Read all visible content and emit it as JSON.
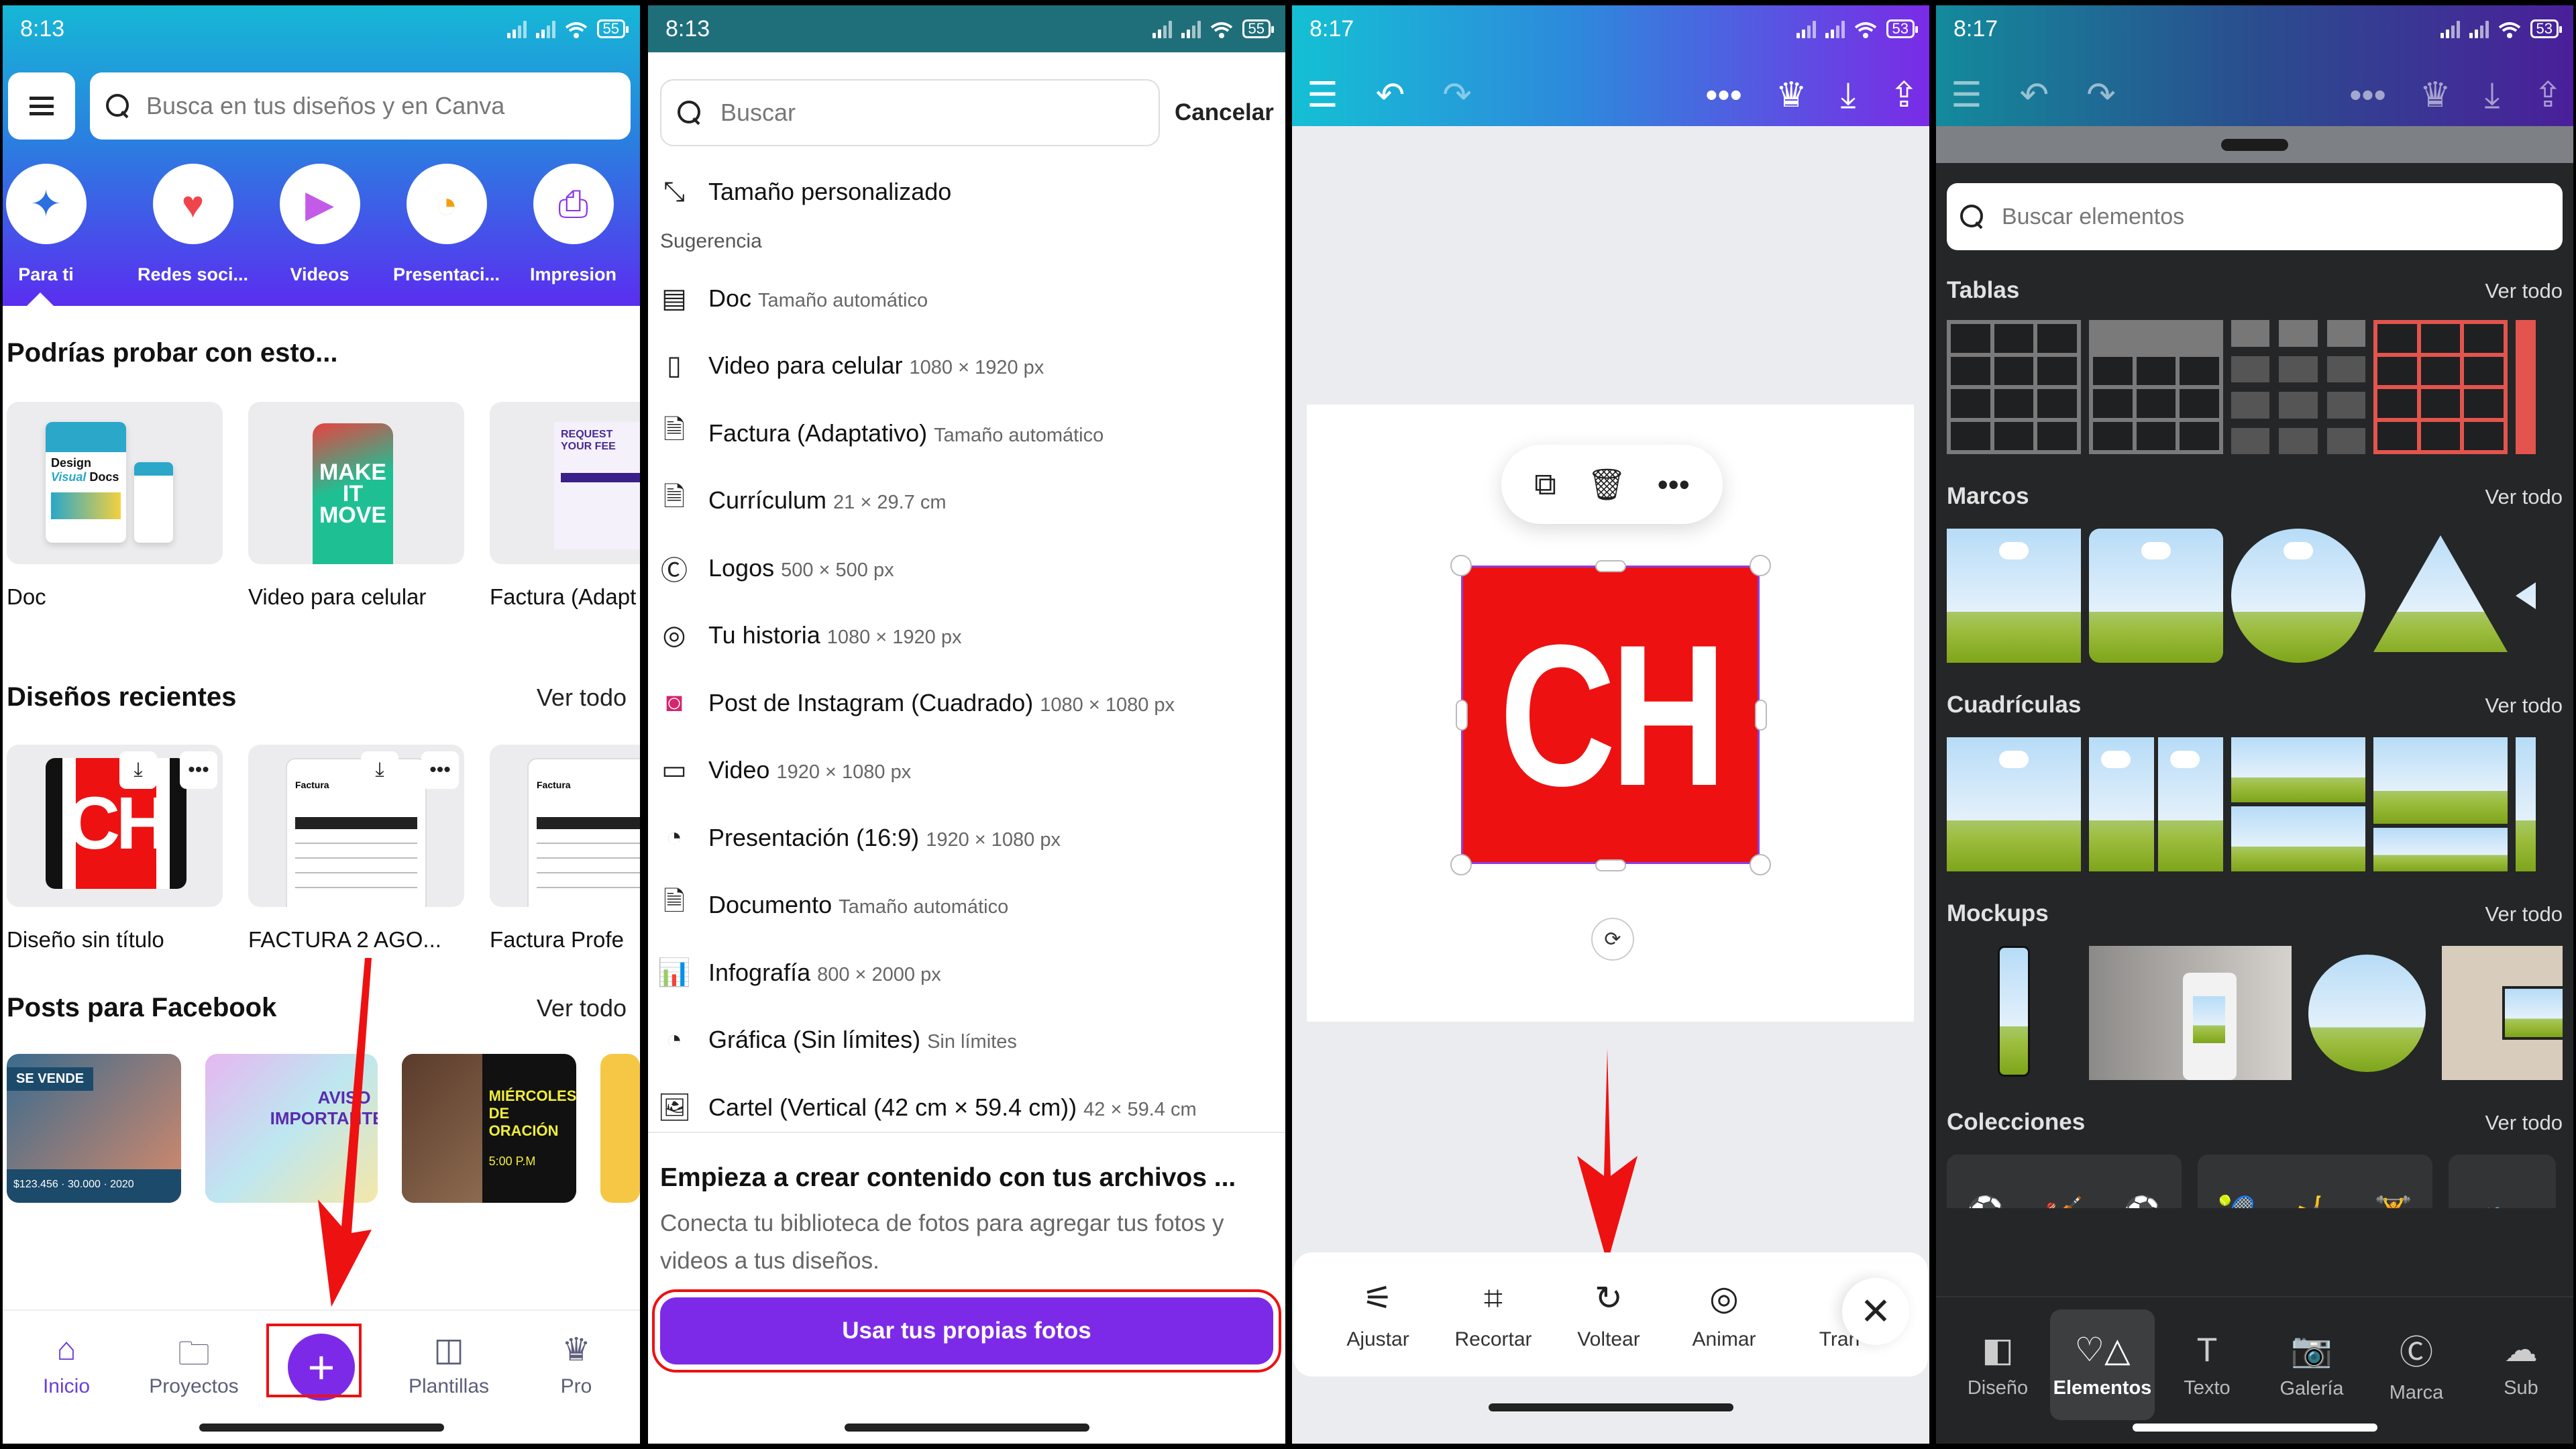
{
  "panel1": {
    "status": {
      "time": "8:13",
      "battery": "55"
    },
    "search_placeholder": "Busca en tus diseños y en Canva",
    "categories": [
      {
        "label": "Para ti",
        "icon": "sparkle-icon",
        "glyph": "✦",
        "color": "#2d6fe0"
      },
      {
        "label": "Redes soci...",
        "icon": "social-heart-icon",
        "glyph": "♥",
        "color": "#f0444d"
      },
      {
        "label": "Videos",
        "icon": "video-camera-icon",
        "glyph": "▶",
        "color": "#c35be8"
      },
      {
        "label": "Presentaci...",
        "icon": "presentation-icon",
        "glyph": "◔",
        "color": "#f59d0e"
      },
      {
        "label": "Impresion",
        "icon": "printer-icon",
        "glyph": "⎙",
        "color": "#8b35e8"
      }
    ],
    "suggest_title": "Podrías probar con esto...",
    "suggest_cards": [
      {
        "name": "Doc"
      },
      {
        "name": "Video para celular"
      },
      {
        "name": "Factura (Adapt"
      }
    ],
    "recent_title": "Diseños recientes",
    "recent_link": "Ver todo",
    "recent_cards": [
      {
        "name": "Diseño sin título"
      },
      {
        "name": "FACTURA 2 AGO..."
      },
      {
        "name": "Factura Profe"
      }
    ],
    "fb_title": "Posts para Facebook",
    "fb_link": "Ver todo",
    "fb_cards": [
      {
        "text": "SE VENDE",
        "sub": "$123.456 · 30.000 · 2020"
      },
      {
        "text": "AVISO IMPORTANTE"
      },
      {
        "text": "MIÉRCOLES DE ORACIÓN",
        "sub": "5:00 P.M"
      }
    ],
    "nav": [
      {
        "label": "Inicio",
        "icon": "home-icon",
        "glyph": "⌂"
      },
      {
        "label": "Proyectos",
        "icon": "folder-icon",
        "glyph": "🗀"
      },
      {
        "label": "",
        "icon": "plus-icon",
        "glyph": "+"
      },
      {
        "label": "Plantillas",
        "icon": "templates-icon",
        "glyph": "◫"
      },
      {
        "label": "Pro",
        "icon": "crown-icon",
        "glyph": "♛"
      }
    ]
  },
  "panel2": {
    "status": {
      "time": "8:13",
      "battery": "55"
    },
    "search_placeholder": "Buscar",
    "cancel": "Cancelar",
    "custom_size": "Tamaño personalizado",
    "suggestion_label": "Sugerencia",
    "items": [
      {
        "title": "Doc",
        "size": "Tamaño automático",
        "icon": "doc-icon",
        "glyph": "▤"
      },
      {
        "title": "Video para celular",
        "size": "1080 × 1920 px",
        "icon": "phone-icon",
        "glyph": "▯"
      },
      {
        "title": "Factura (Adaptativo)",
        "size": "Tamaño automático",
        "icon": "invoice-icon",
        "glyph": "🗎"
      },
      {
        "title": "Currículum",
        "size": "21 × 29.7 cm",
        "icon": "resume-icon",
        "glyph": "🗎"
      },
      {
        "title": "Logos",
        "size": "500 × 500 px",
        "icon": "logo-icon",
        "glyph": "Ⓒ"
      },
      {
        "title": "Tu historia",
        "size": "1080 × 1920 px",
        "icon": "story-camera-icon",
        "glyph": "◎"
      },
      {
        "title": "Post de Instagram (Cuadrado)",
        "size": "1080 × 1080 px",
        "icon": "instagram-icon",
        "glyph": "◙"
      },
      {
        "title": "Video",
        "size": "1920 × 1080 px",
        "icon": "video-icon",
        "glyph": "▭"
      },
      {
        "title": "Presentación (16:9)",
        "size": "1920 × 1080 px",
        "icon": "presentation-icon",
        "glyph": "◔"
      },
      {
        "title": "Documento",
        "size": "Tamaño automático",
        "icon": "document-icon",
        "glyph": "🗎"
      },
      {
        "title": "Infografía",
        "size": "800 × 2000 px",
        "icon": "infographic-icon",
        "glyph": "📊"
      },
      {
        "title": "Gráfica (Sin límites)",
        "size": "Sin límites",
        "icon": "graphic-icon",
        "glyph": "◔"
      },
      {
        "title": "Cartel (Vertical (42 cm × 59.4 cm))",
        "size": "42 × 59.4 cm",
        "icon": "poster-icon",
        "glyph": "🖼"
      }
    ],
    "upload_title": "Empieza a crear contenido con tus archivos ...",
    "upload_desc": "Conecta tu biblioteca de fotos para agregar tus fotos y videos a tus diseños.",
    "upload_button": "Usar tus propias fotos"
  },
  "panel3": {
    "status": {
      "time": "8:17",
      "battery": "53"
    },
    "logo_text": "CH",
    "logo_color": "#ee1111",
    "edit_items": [
      {
        "label": "Ajustar",
        "icon": "sliders-icon",
        "glyph": "⚟"
      },
      {
        "label": "Recortar",
        "icon": "crop-icon",
        "glyph": "⌗"
      },
      {
        "label": "Voltear",
        "icon": "flip-icon",
        "glyph": "↻"
      },
      {
        "label": "Animar",
        "icon": "animate-icon",
        "glyph": "◎"
      },
      {
        "label": "Tran",
        "icon": "transparency-icon",
        "glyph": ""
      }
    ]
  },
  "panel4": {
    "status": {
      "time": "8:17",
      "battery": "53"
    },
    "search_placeholder": "Buscar elementos",
    "sections": [
      {
        "title": "Tablas",
        "link": "Ver todo"
      },
      {
        "title": "Marcos",
        "link": "Ver todo"
      },
      {
        "title": "Cuadrículas",
        "link": "Ver todo"
      },
      {
        "title": "Mockups",
        "link": "Ver todo"
      },
      {
        "title": "Colecciones",
        "link": "Ver todo"
      }
    ],
    "nav": [
      {
        "label": "Diseño",
        "icon": "design-icon",
        "glyph": "◧"
      },
      {
        "label": "Elementos",
        "icon": "elements-icon",
        "glyph": "♡△"
      },
      {
        "label": "Texto",
        "icon": "text-icon",
        "glyph": "T"
      },
      {
        "label": "Galería",
        "icon": "camera-icon",
        "glyph": "📷"
      },
      {
        "label": "Marca",
        "icon": "brand-icon",
        "glyph": "Ⓒ"
      },
      {
        "label": "Sub",
        "icon": "upload-icon",
        "glyph": "☁"
      }
    ]
  },
  "colors": {
    "accent": "#7d2ae8",
    "annotation": "#ee1111"
  }
}
